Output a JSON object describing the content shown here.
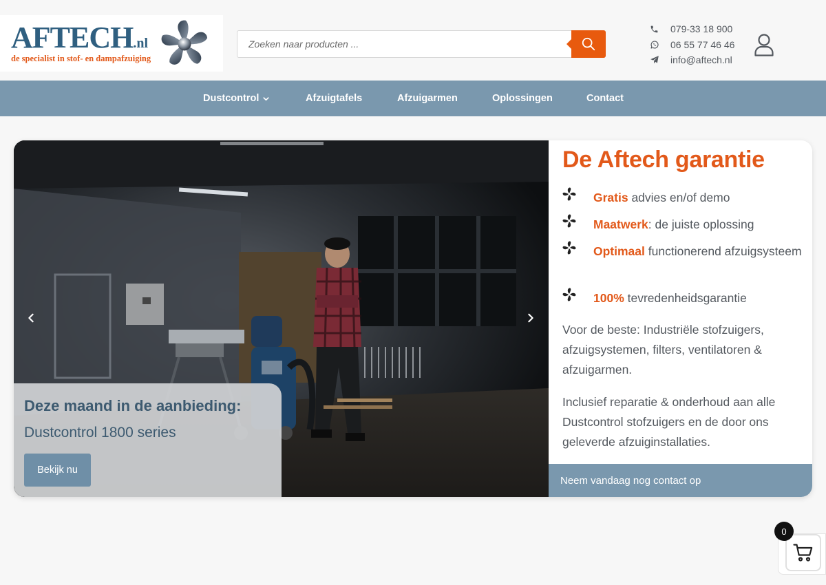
{
  "header": {
    "logo": {
      "name": "AFTECH",
      "suffix": ".nl",
      "tagline": "de specialist in stof- en dampafzuiging"
    },
    "search": {
      "placeholder": "Zoeken naar producten ..."
    },
    "contacts": [
      {
        "icon": "phone-icon",
        "text": "079-33 18 900"
      },
      {
        "icon": "whatsapp-icon",
        "text": "06 55 77 46 46"
      },
      {
        "icon": "send-icon",
        "text": "info@aftech.nl"
      }
    ]
  },
  "nav": {
    "items": [
      {
        "label": "Dustcontrol",
        "has_dropdown": true
      },
      {
        "label": "Afzuigtafels"
      },
      {
        "label": "Afzuigarmen"
      },
      {
        "label": "Oplossingen"
      },
      {
        "label": "Contact"
      }
    ]
  },
  "hero": {
    "promo": {
      "title": "Deze maand in de aanbieding:",
      "subtitle": "Dustcontrol 1800 series",
      "button": "Bekijk nu"
    },
    "panel": {
      "title": "De Aftech garantie",
      "features": [
        {
          "highlight": "Gratis",
          "rest": " advies en/of demo"
        },
        {
          "highlight": "Maatwerk",
          "rest": ": de juiste oplossing"
        },
        {
          "highlight": "Optimaal",
          "rest": " functionerend afzuigsysteem"
        },
        {
          "highlight": "100%",
          "rest": " tevredenheidsgarantie"
        }
      ],
      "paragraph1": "Voor de beste: Industriële stofzuigers, afzuigsystemen, filters, ventilatoren & afzuigarmen.",
      "paragraph2": "Inclusief reparatie & onderhoud aan alle Dustcontrol stofzuigers en de door ons geleverde afzuiginstallaties.",
      "cta": "Neem vandaag nog contact op"
    }
  },
  "cart": {
    "count": "0"
  },
  "colors": {
    "accent": "#e85a0e",
    "nav": "#7a98ae",
    "brand_blue": "#2f5f80"
  }
}
